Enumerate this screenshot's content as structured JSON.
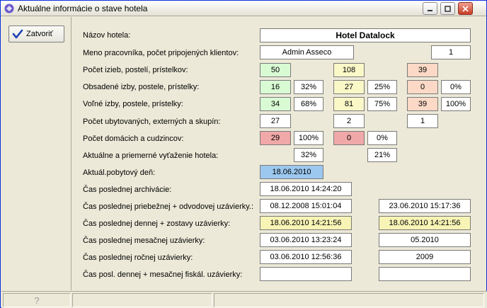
{
  "window": {
    "title": "Aktuálne informácie o stave hotela"
  },
  "toolbar": {
    "close_label": "Zatvoriť",
    "close_icon": "checkmark-icon"
  },
  "labels": {
    "hotel_name": "Názov hotela:",
    "employee": "Meno pracovníka, počet pripojených klientov:",
    "rooms_count": "Počet izieb, postelí, prístelkov:",
    "occupied": "Obsadené izby, postele, prístelky:",
    "free": "Voľné  izby, postele, prístelky:",
    "guests": "Počet ubytovaných, externých a skupín:",
    "domestic_foreign": "Počet domácich a cudzincov:",
    "occupancy": "Aktuálne a priemerné vyťaženie hotela:",
    "day": "Aktuál.pobytový deň:",
    "archive": "Čas poslednej archivácie:",
    "interim": "Čas poslednej priebežnej + odvodovej uzávierky.:",
    "daily": "Čas poslednej dennej + zostavy uzávierky:",
    "monthly": "Čas poslednej mesačnej uzávierky:",
    "yearly": "Čas poslednej ročnej uzávierky:",
    "fiscal": "Čas posl. dennej + mesačnej fiskál. uzávierky:"
  },
  "values": {
    "hotel_name": "Hotel Datalock",
    "employee": "Admin Asseco",
    "clients": "1",
    "rooms": "50",
    "beds": "108",
    "extra_beds": "39",
    "occ_rooms": "16",
    "occ_rooms_pct": "32%",
    "occ_beds": "27",
    "occ_beds_pct": "25%",
    "occ_extra": "0",
    "occ_extra_pct": "0%",
    "free_rooms": "34",
    "free_rooms_pct": "68%",
    "free_beds": "81",
    "free_beds_pct": "75%",
    "free_extra": "39",
    "free_extra_pct": "100%",
    "guests": "27",
    "external": "2",
    "groups": "1",
    "domestic": "29",
    "domestic_pct": "100%",
    "foreign": "0",
    "foreign_pct": "0%",
    "occ_current": "32%",
    "occ_avg": "21%",
    "day": "18.06.2010",
    "archive": "18.06.2010 14:24:20",
    "interim_1": "08.12.2008 15:01:04",
    "interim_2": "23.06.2010 15:17:36",
    "daily_1": "18.06.2010 14:21:56",
    "daily_2": "18.06.2010 14:21:56",
    "monthly_1": "03.06.2010 13:23:24",
    "monthly_2": "05.2010",
    "yearly_1": "03.06.2010 12:56:36",
    "yearly_2": "2009",
    "fiscal_1": "",
    "fiscal_2": ""
  },
  "statusbar": {
    "help_icon": "question-icon"
  }
}
